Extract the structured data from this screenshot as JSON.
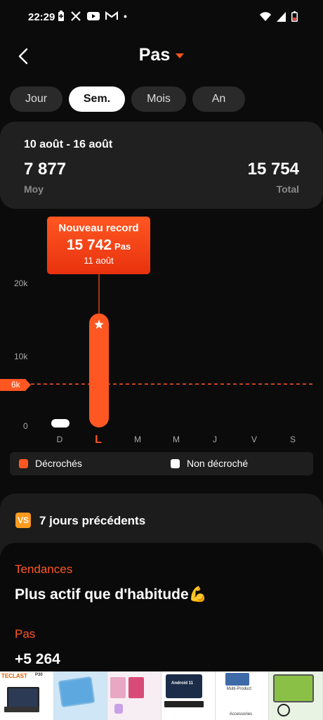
{
  "status_bar": {
    "time": "22:29",
    "dot": "•"
  },
  "header": {
    "title": "Pas"
  },
  "tabs": [
    {
      "label": "Jour",
      "active": false
    },
    {
      "label": "Sem.",
      "active": true
    },
    {
      "label": "Mois",
      "active": false
    },
    {
      "label": "An",
      "active": false
    }
  ],
  "summary": {
    "range": "10 août - 16 août",
    "average_value": "7 877",
    "average_label": "Moy",
    "total_value": "15 754",
    "total_label": "Total"
  },
  "chart": {
    "y_ticks": [
      "20k",
      "10k",
      "0"
    ],
    "goal_label": "6k",
    "record": {
      "title": "Nouveau record",
      "value": "15 742",
      "unit": "Pas",
      "date": "11 août"
    },
    "x_labels": [
      "D",
      "L",
      "M",
      "M",
      "J",
      "V",
      "S"
    ]
  },
  "chart_data": {
    "type": "bar",
    "categories": [
      "D",
      "L",
      "M",
      "M",
      "J",
      "V",
      "S"
    ],
    "values": [
      12,
      15742,
      null,
      null,
      null,
      null,
      null
    ],
    "goal": 6000,
    "ylim": [
      0,
      20000
    ],
    "selected": "L",
    "colors": {
      "achieved": "#ff5722",
      "not_achieved": "#ffffff",
      "goal_line": "#ff5722"
    }
  },
  "legend": {
    "achieved": "Décrochés",
    "not_achieved": "Non décroché"
  },
  "previous": {
    "icon_text": "VS",
    "title": "7 jours précédents",
    "trend_heading": "Tendances",
    "trend_text": "Plus actif que d'habitude💪",
    "steps_heading": "Pas",
    "steps_value": "+5 264"
  },
  "ad": {
    "brand": "TECLAST",
    "model": "P30",
    "badge": "Android 11",
    "caption": "Multi-Product",
    "accessories": "Accessories"
  }
}
